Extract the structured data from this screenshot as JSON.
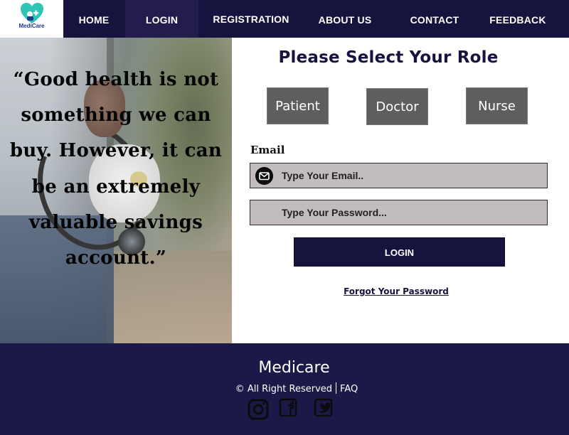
{
  "brand": {
    "logo_text": "MediCare"
  },
  "nav": {
    "items": [
      {
        "label": "HOME"
      },
      {
        "label": "LOGIN",
        "active": true
      },
      {
        "label": "REGISTRATION"
      },
      {
        "label": "ABOUT US"
      },
      {
        "label": "CONTACT"
      },
      {
        "label": "FEEDBACK"
      }
    ]
  },
  "hero": {
    "quote": "“Good health is not something we can buy. However, it can be an extremely valuable savings account.”"
  },
  "login_form": {
    "title": "Please Select Your Role",
    "roles": [
      "Patient",
      "Doctor",
      "Nurse"
    ],
    "email_label": "Email",
    "email_placeholder": "Type Your Email..",
    "password_placeholder": "Type Your Password...",
    "submit_label": "LOGIN",
    "forgot_link": "Forgot Your Password"
  },
  "footer": {
    "brand": "Medicare",
    "copyright": "© All Right Reserved",
    "faq": "FAQ",
    "social_icons": [
      "instagram-icon",
      "facebook-icon",
      "twitter-icon"
    ]
  },
  "colors": {
    "nav_bg": "#17133f",
    "footer_bg": "#1c1948",
    "role_button_bg": "#5e5e5e",
    "input_bg": "#c2bcbd",
    "logo_heart": "#2ec4b6"
  }
}
